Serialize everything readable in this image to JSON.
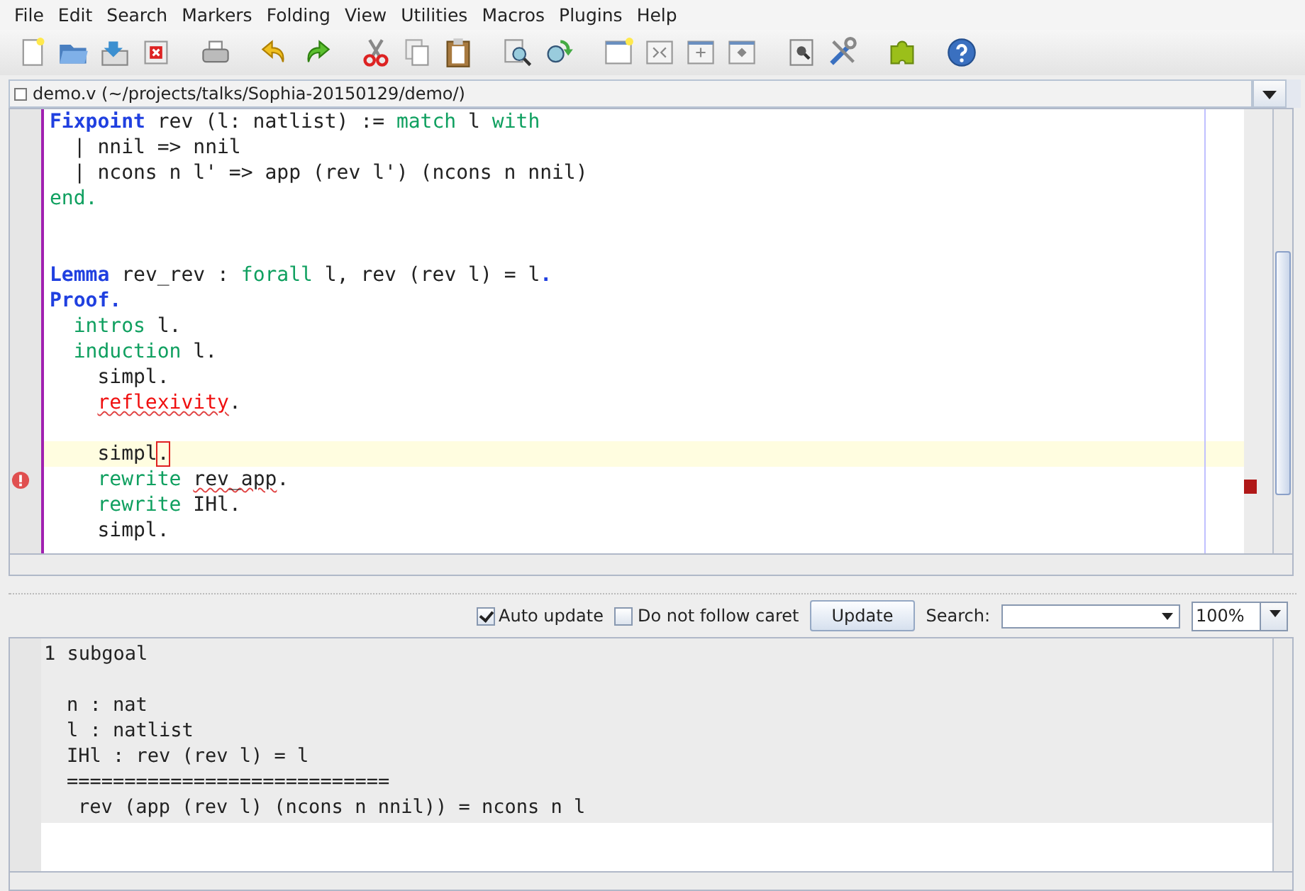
{
  "menu": [
    "File",
    "Edit",
    "Search",
    "Markers",
    "Folding",
    "View",
    "Utilities",
    "Macros",
    "Plugins",
    "Help"
  ],
  "toolbar": [
    {
      "kind": "new"
    },
    {
      "kind": "open"
    },
    {
      "kind": "save"
    },
    {
      "kind": "close"
    },
    {
      "kind": "sep"
    },
    {
      "kind": "print"
    },
    {
      "kind": "sep"
    },
    {
      "kind": "undo"
    },
    {
      "kind": "redo"
    },
    {
      "kind": "sep"
    },
    {
      "kind": "cut"
    },
    {
      "kind": "copy"
    },
    {
      "kind": "paste"
    },
    {
      "kind": "sep"
    },
    {
      "kind": "find"
    },
    {
      "kind": "replace"
    },
    {
      "kind": "sep"
    },
    {
      "kind": "newview"
    },
    {
      "kind": "split"
    },
    {
      "kind": "splith"
    },
    {
      "kind": "splitv"
    },
    {
      "kind": "sep"
    },
    {
      "kind": "docsearch"
    },
    {
      "kind": "tools"
    },
    {
      "kind": "sep"
    },
    {
      "kind": "plugin"
    },
    {
      "kind": "sep"
    },
    {
      "kind": "help"
    }
  ],
  "buffer": {
    "title": "demo.v (~/projects/talks/Sophia-20150129/demo/)"
  },
  "editor": {
    "lines": [
      {
        "tokens": [
          {
            "text": "Fixpoint",
            "kind": "keyword"
          },
          {
            "text": " rev (l: natlist) := ",
            "kind": "plain"
          },
          {
            "text": "match",
            "kind": "tactic"
          },
          {
            "text": " l ",
            "kind": "plain"
          },
          {
            "text": "with",
            "kind": "tactic"
          }
        ],
        "current": false,
        "error": false
      },
      {
        "tokens": [
          {
            "text": "  | nnil => nnil",
            "kind": "plain"
          }
        ],
        "current": false,
        "error": false
      },
      {
        "tokens": [
          {
            "text": "  | ncons n l' => app (rev l') (ncons n nnil)",
            "kind": "plain"
          }
        ],
        "current": false,
        "error": false
      },
      {
        "tokens": [
          {
            "text": "end.",
            "kind": "tactic"
          }
        ],
        "current": false,
        "error": false
      },
      {
        "current": false,
        "error": false
      },
      {
        "current": false,
        "error": false
      },
      {
        "tokens": [
          {
            "text": "Lemma",
            "kind": "keyword"
          },
          {
            "text": " rev_rev : ",
            "kind": "plain"
          },
          {
            "text": "forall",
            "kind": "tactic"
          },
          {
            "text": " l, rev (rev l) = l",
            "kind": "plain"
          },
          {
            "text": ".",
            "kind": "keyword"
          }
        ],
        "current": false,
        "error": false
      },
      {
        "tokens": [
          {
            "text": "Proof.",
            "kind": "keyword"
          }
        ],
        "current": false,
        "error": false
      },
      {
        "tokens": [
          {
            "text": "  intros",
            "kind": "tactic"
          },
          {
            "text": " l.",
            "kind": "plain"
          }
        ],
        "current": false,
        "error": false
      },
      {
        "tokens": [
          {
            "text": "  induction",
            "kind": "tactic"
          },
          {
            "text": " l.",
            "kind": "plain"
          }
        ],
        "current": false,
        "error": false
      },
      {
        "tokens": [
          {
            "text": "    simpl.",
            "kind": "plain"
          }
        ],
        "current": false,
        "error": false
      },
      {
        "tokens": [
          {
            "text": "    reflexivity",
            "kind": "error"
          },
          {
            "text": ".",
            "kind": "plain"
          }
        ],
        "current": false,
        "error": false
      },
      {
        "current": false,
        "error": false
      },
      {
        "tokens": [
          {
            "text": "    simpl",
            "kind": "plain"
          },
          {
            "text": ".",
            "kind": "caret"
          }
        ],
        "current": true,
        "error": false
      },
      {
        "tokens": [
          {
            "text": "    rewrite",
            "kind": "tactic"
          },
          {
            "text": " rev_app",
            "kind": "misspelled"
          },
          {
            "text": ".",
            "kind": "plain"
          }
        ],
        "current": false,
        "error": true
      },
      {
        "tokens": [
          {
            "text": "    rewrite",
            "kind": "tactic"
          },
          {
            "text": " IHl.",
            "kind": "plain"
          }
        ],
        "current": false,
        "error": false
      },
      {
        "tokens": [
          {
            "text": "    simpl.",
            "kind": "plain"
          }
        ],
        "current": false,
        "error": false
      }
    ]
  },
  "options": {
    "auto_update": {
      "label": "Auto update",
      "checked": true
    },
    "no_follow": {
      "label": "Do not follow caret",
      "checked": false
    },
    "update_button": "Update",
    "search_label": "Search:",
    "zoom": "100%"
  },
  "goals": {
    "header": "1 subgoal",
    "hypotheses": [
      "n : nat",
      "l : natlist",
      "IHl : rev (rev l) = l"
    ],
    "separator": "============================",
    "conclusion": "rev (app (rev l) (ncons n nnil)) = ncons n l"
  }
}
